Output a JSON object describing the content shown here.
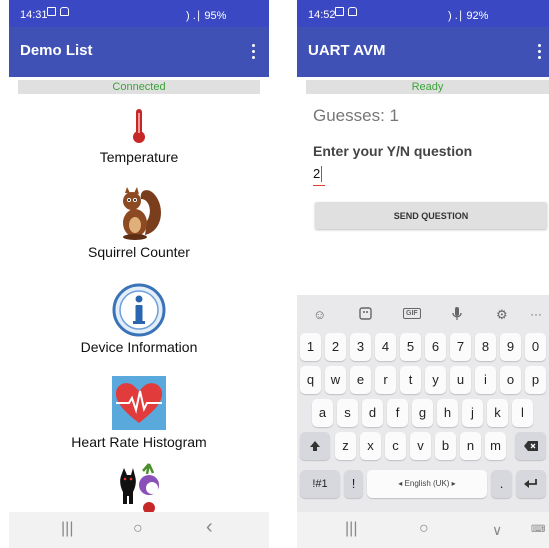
{
  "phone1": {
    "status_time": "14:31",
    "status_right": ") .∣ 95%",
    "title": "Demo List",
    "connection": "Connected",
    "items": [
      {
        "label": "Temperature",
        "icon": "thermometer-icon"
      },
      {
        "label": "Squirrel Counter",
        "icon": "squirrel-icon"
      },
      {
        "label": "Device Information",
        "icon": "info-icon"
      },
      {
        "label": "Heart Rate Histogram",
        "icon": "heart-rate-icon"
      },
      {
        "label": "",
        "icon": "cat-turnip-icon"
      }
    ],
    "nav": [
      "|||",
      "○",
      "‹"
    ]
  },
  "phone2": {
    "status_time": "14:52",
    "status_right": ") .∣ 92%",
    "title": "UART AVM",
    "status": "Ready",
    "guesses": "Guesses: 1",
    "prompt": "Enter your Y/N question",
    "input_value": "2",
    "send_label": "SEND QUESTION",
    "keyboard": {
      "row_numbers": [
        "1",
        "2",
        "3",
        "4",
        "5",
        "6",
        "7",
        "8",
        "9",
        "0"
      ],
      "row_q": [
        "q",
        "w",
        "e",
        "r",
        "t",
        "y",
        "u",
        "i",
        "o",
        "p"
      ],
      "row_a": [
        "a",
        "s",
        "d",
        "f",
        "g",
        "h",
        "j",
        "k",
        "l"
      ],
      "row_z": [
        "z",
        "x",
        "c",
        "v",
        "b",
        "n",
        "m"
      ],
      "symbols": "!#1",
      "exclaim": "!",
      "space": "◂ English (UK) ▸",
      "period": ".",
      "gif": "GIF",
      "more": "···"
    },
    "nav": [
      "|||",
      "○",
      "∨"
    ]
  },
  "colors": {
    "statusbar": "#3a48c3",
    "appbar": "#3f51b5",
    "connected": "#3aa33a",
    "accent": "#e53935"
  }
}
